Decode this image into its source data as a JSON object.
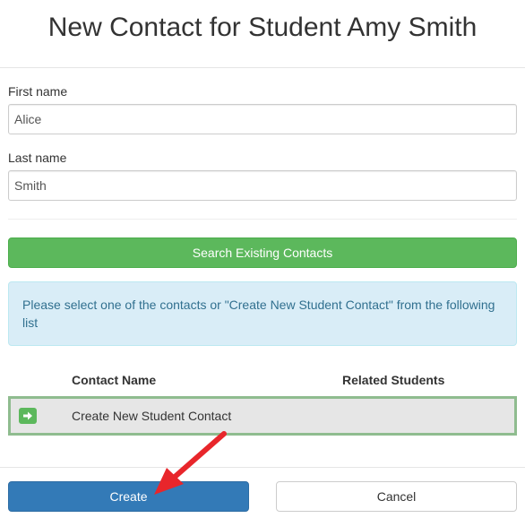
{
  "modal": {
    "title": "New Contact for Student Amy Smith"
  },
  "form": {
    "first_name_label": "First name",
    "first_name_value": "Alice",
    "last_name_label": "Last name",
    "last_name_value": "Smith"
  },
  "search": {
    "button_label": "Search Existing Contacts"
  },
  "info": {
    "message": "Please select one of the contacts or \"Create New Student Contact\" from the following list"
  },
  "table": {
    "columns": [
      "Contact Name",
      "Related Students"
    ],
    "rows": [
      {
        "icon": "arrow-right-icon",
        "name": "Create New Student Contact",
        "related_students": ""
      }
    ]
  },
  "footer": {
    "create_label": "Create",
    "cancel_label": "Cancel"
  },
  "colors": {
    "success": "#5cb85c",
    "primary": "#337ab7",
    "info_bg": "#d9edf7",
    "info_text": "#31708f",
    "annotation": "#e8262b"
  }
}
